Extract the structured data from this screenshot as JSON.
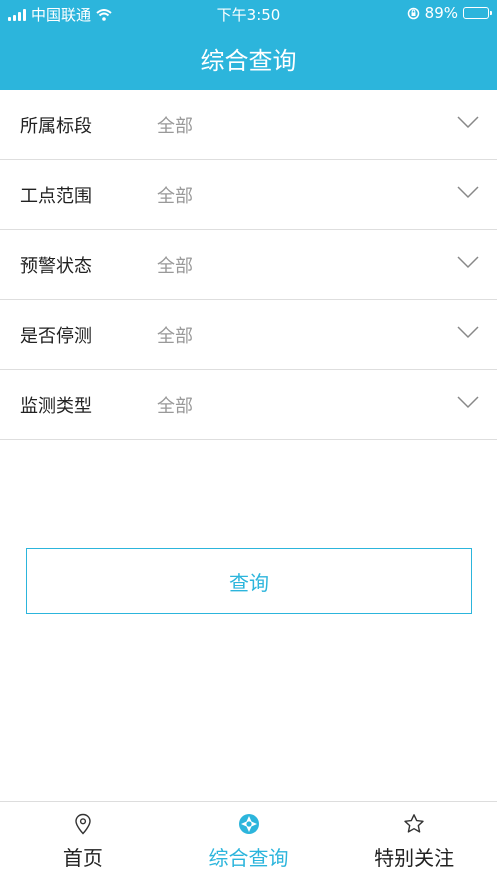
{
  "status_bar": {
    "carrier": "中国联通",
    "time": "下午3:50",
    "battery_percent": "89%",
    "battery_level": 0.89
  },
  "nav": {
    "title": "综合查询"
  },
  "filters": [
    {
      "label": "所属标段",
      "value": "全部"
    },
    {
      "label": "工点范围",
      "value": "全部"
    },
    {
      "label": "预警状态",
      "value": "全部"
    },
    {
      "label": "是否停测",
      "value": "全部"
    },
    {
      "label": "监测类型",
      "value": "全部"
    }
  ],
  "query_button": {
    "label": "查询"
  },
  "tabs": [
    {
      "label": "首页",
      "icon": "location-pin-icon",
      "active": false
    },
    {
      "label": "综合查询",
      "icon": "compass-icon",
      "active": true
    },
    {
      "label": "特别关注",
      "icon": "star-icon",
      "active": false
    }
  ],
  "colors": {
    "accent": "#2cb5dc",
    "placeholder": "#999999",
    "divider": "#dedede"
  }
}
